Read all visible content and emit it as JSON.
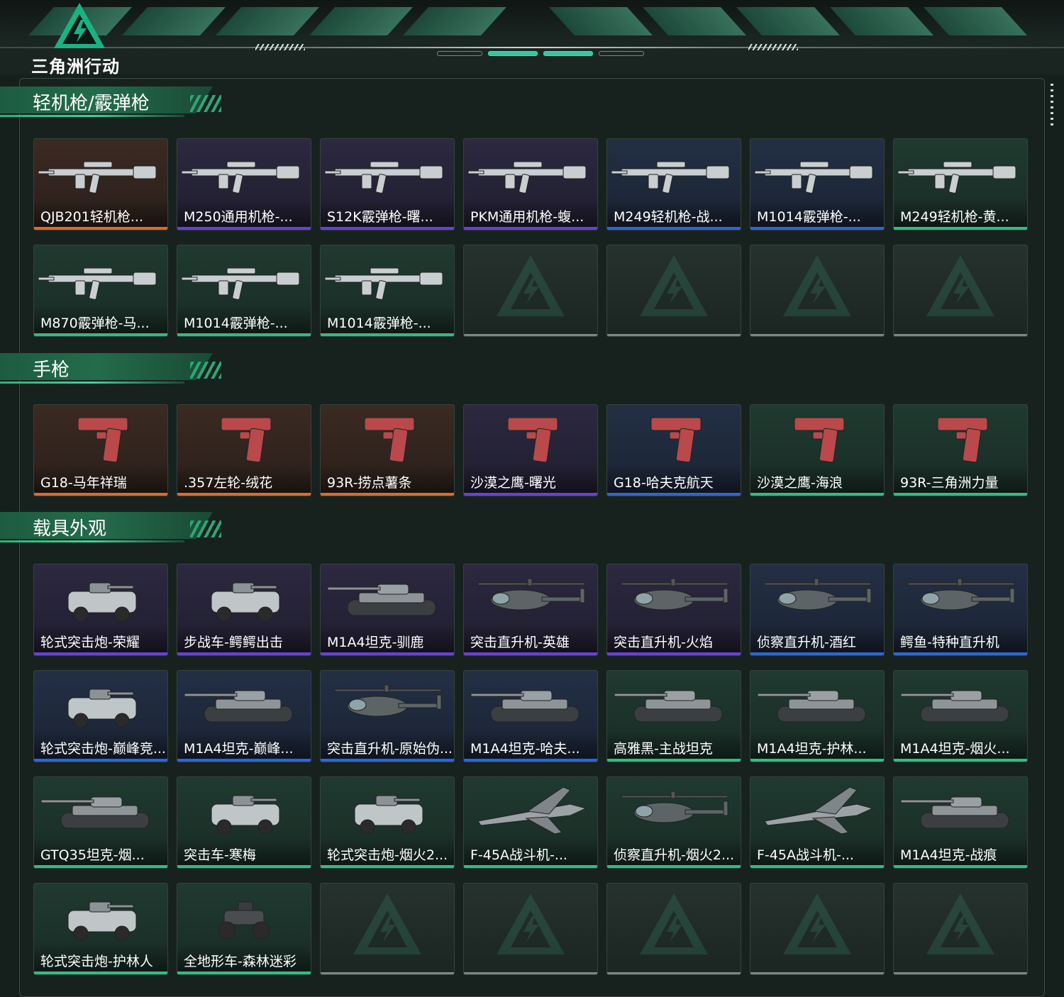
{
  "app": {
    "logo_text": "三角洲行动"
  },
  "colors": {
    "orange": "#e06a2a",
    "purple": "#6a3fd8",
    "blue": "#2f65d6",
    "green": "#2dbf80",
    "accent": "#2ec9a0"
  },
  "sections": [
    {
      "title": "轻机枪/霰弹枪",
      "items": [
        {
          "label": "QJB201轻机枪...",
          "rarity": "orange",
          "icon": "rifle-icon"
        },
        {
          "label": "M250通用机枪-...",
          "rarity": "purple",
          "icon": "rifle-icon"
        },
        {
          "label": "S12K霰弹枪-曙...",
          "rarity": "purple",
          "icon": "rifle-icon"
        },
        {
          "label": "PKM通用机枪-蝮...",
          "rarity": "purple",
          "icon": "rifle-icon"
        },
        {
          "label": "M249轻机枪-战...",
          "rarity": "blue",
          "icon": "rifle-icon"
        },
        {
          "label": "M1014霰弹枪-...",
          "rarity": "blue",
          "icon": "rifle-icon"
        },
        {
          "label": "M249轻机枪-黄...",
          "rarity": "green",
          "icon": "rifle-icon"
        },
        {
          "label": "M870霰弹枪-马...",
          "rarity": "green",
          "icon": "rifle-icon"
        },
        {
          "label": "M1014霰弹枪-...",
          "rarity": "green",
          "icon": "rifle-icon"
        },
        {
          "label": "M1014霰弹枪-...",
          "rarity": "green",
          "icon": "rifle-icon"
        },
        {
          "label": "",
          "rarity": "empty"
        },
        {
          "label": "",
          "rarity": "empty"
        },
        {
          "label": "",
          "rarity": "empty"
        },
        {
          "label": "",
          "rarity": "empty"
        }
      ]
    },
    {
      "title": "手枪",
      "items": [
        {
          "label": "G18-马年祥瑞",
          "rarity": "orange",
          "icon": "pistol-icon"
        },
        {
          "label": ".357左轮-绒花",
          "rarity": "orange",
          "icon": "pistol-icon"
        },
        {
          "label": "93R-捞点薯条",
          "rarity": "orange",
          "icon": "pistol-icon"
        },
        {
          "label": "沙漠之鹰-曙光",
          "rarity": "purple",
          "icon": "pistol-icon"
        },
        {
          "label": "G18-哈夫克航天",
          "rarity": "blue",
          "icon": "pistol-icon"
        },
        {
          "label": "沙漠之鹰-海浪",
          "rarity": "green",
          "icon": "pistol-icon"
        },
        {
          "label": "93R-三角洲力量",
          "rarity": "green",
          "icon": "pistol-icon"
        }
      ]
    },
    {
      "title": "载具外观",
      "items": [
        {
          "label": "轮式突击炮-荣耀",
          "rarity": "purple",
          "icon": "vehicle-icon"
        },
        {
          "label": "步战车-鳄鳄出击",
          "rarity": "purple",
          "icon": "vehicle-icon"
        },
        {
          "label": "M1A4坦克-驯鹿",
          "rarity": "purple",
          "icon": "tank-icon"
        },
        {
          "label": "突击直升机-英雄",
          "rarity": "purple",
          "icon": "helicopter-icon"
        },
        {
          "label": "突击直升机-火焰",
          "rarity": "purple",
          "icon": "helicopter-icon"
        },
        {
          "label": "侦察直升机-酒红",
          "rarity": "blue",
          "icon": "helicopter-icon"
        },
        {
          "label": "鳄鱼-特种直升机",
          "rarity": "blue",
          "icon": "helicopter-icon"
        },
        {
          "label": "轮式突击炮-巅峰竞...",
          "rarity": "blue",
          "icon": "vehicle-icon"
        },
        {
          "label": "M1A4坦克-巅峰...",
          "rarity": "blue",
          "icon": "tank-icon"
        },
        {
          "label": "突击直升机-原始伪...",
          "rarity": "blue",
          "icon": "helicopter-icon"
        },
        {
          "label": "M1A4坦克-哈夫...",
          "rarity": "blue",
          "icon": "tank-icon"
        },
        {
          "label": "高雅黑-主战坦克",
          "rarity": "green",
          "icon": "tank-icon"
        },
        {
          "label": "M1A4坦克-护林...",
          "rarity": "green",
          "icon": "tank-icon"
        },
        {
          "label": "M1A4坦克-烟火...",
          "rarity": "green",
          "icon": "tank-icon"
        },
        {
          "label": "GTQ35坦克-烟...",
          "rarity": "green",
          "icon": "tank-icon"
        },
        {
          "label": "突击车-寒梅",
          "rarity": "green",
          "icon": "vehicle-icon"
        },
        {
          "label": "轮式突击炮-烟火2...",
          "rarity": "green",
          "icon": "vehicle-icon"
        },
        {
          "label": "F-45A战斗机-...",
          "rarity": "green",
          "icon": "jet-icon"
        },
        {
          "label": "侦察直升机-烟火2...",
          "rarity": "green",
          "icon": "helicopter-icon"
        },
        {
          "label": "F-45A战斗机-...",
          "rarity": "green",
          "icon": "jet-icon"
        },
        {
          "label": "M1A4坦克-战痕",
          "rarity": "green",
          "icon": "tank-icon"
        },
        {
          "label": "轮式突击炮-护林人",
          "rarity": "green",
          "icon": "vehicle-icon"
        },
        {
          "label": "全地形车-森林迷彩",
          "rarity": "green",
          "icon": "atv-icon"
        },
        {
          "label": "",
          "rarity": "empty"
        },
        {
          "label": "",
          "rarity": "empty"
        },
        {
          "label": "",
          "rarity": "empty"
        },
        {
          "label": "",
          "rarity": "empty"
        },
        {
          "label": "",
          "rarity": "empty"
        }
      ]
    }
  ]
}
